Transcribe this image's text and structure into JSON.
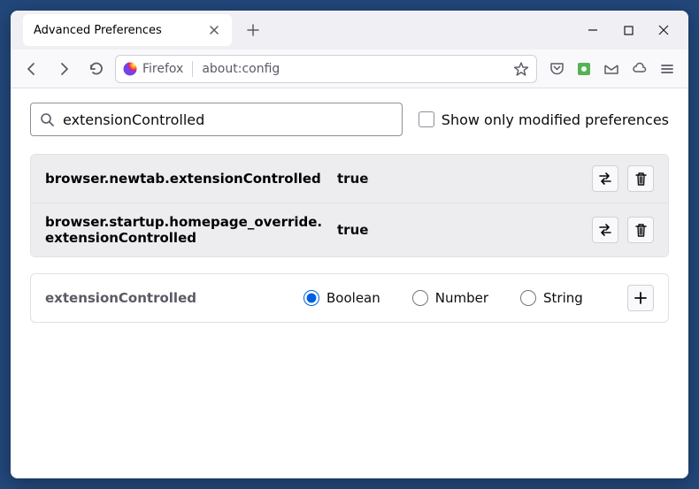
{
  "window": {
    "tab_title": "Advanced Preferences",
    "identity_label": "Firefox",
    "url": "about:config"
  },
  "search": {
    "value": "extensionControlled",
    "checkbox_label": "Show only modified preferences"
  },
  "prefs": [
    {
      "name": "browser.newtab.extensionControlled",
      "value": "true"
    },
    {
      "name": "browser.startup.homepage_override.extensionControlled",
      "value": "true"
    }
  ],
  "new_pref": {
    "name": "extensionControlled",
    "types": {
      "boolean": "Boolean",
      "number": "Number",
      "string": "String"
    }
  }
}
